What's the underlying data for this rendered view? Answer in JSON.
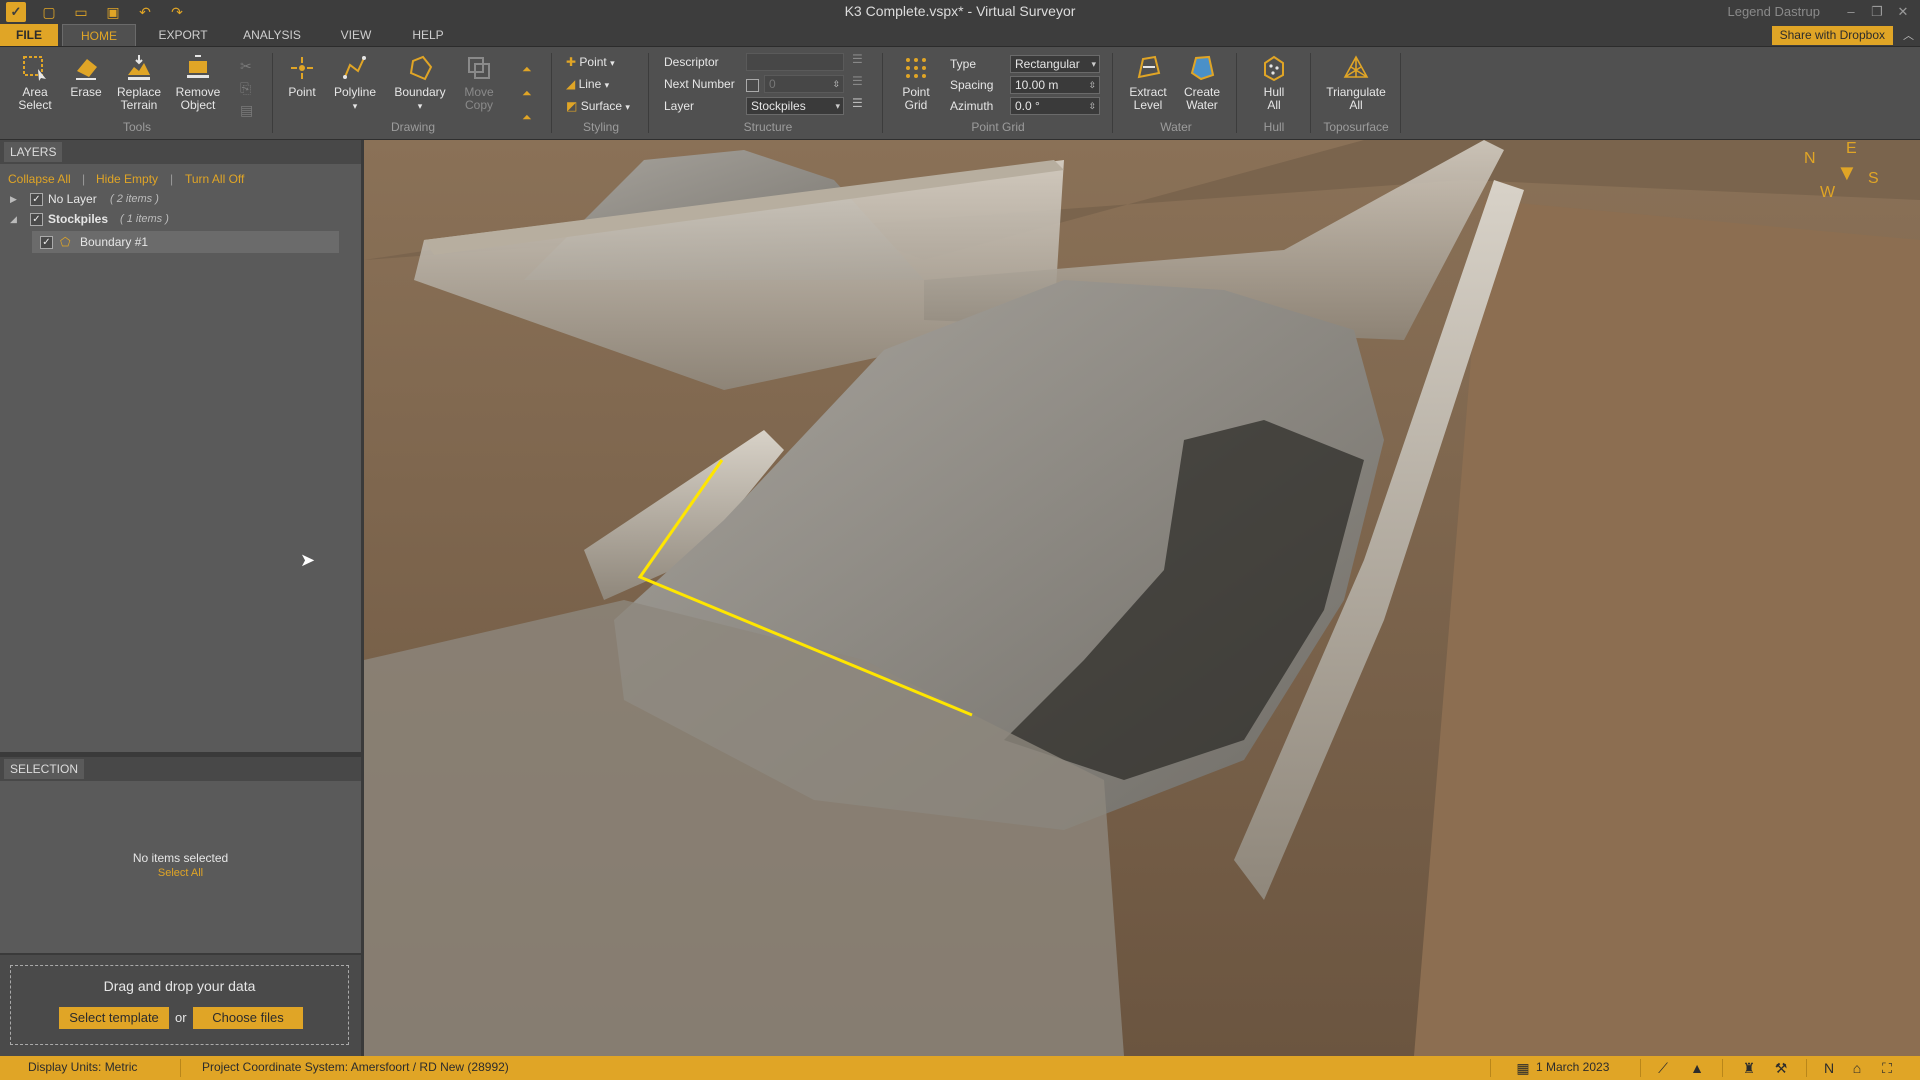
{
  "window": {
    "title": "K3 Complete.vspx*  -  Virtual Surveyor",
    "user": "Legend Dastrup",
    "share_button": "Share with Dropbox",
    "controls": {
      "minimize": "–",
      "restore": "❐",
      "close": "✕"
    }
  },
  "tabs": {
    "file": "FILE",
    "home": "HOME",
    "export": "EXPORT",
    "analysis": "ANALYSIS",
    "view": "VIEW",
    "help": "HELP"
  },
  "ribbon": {
    "tools": {
      "group_label": "Tools",
      "area_select": [
        "Area",
        "Select"
      ],
      "erase": "Erase",
      "replace_terrain": [
        "Replace",
        "Terrain"
      ],
      "remove_object": [
        "Remove",
        "Object"
      ]
    },
    "drawing": {
      "group_label": "Drawing",
      "point": "Point",
      "polyline": "Polyline",
      "boundary": "Boundary",
      "move_copy": [
        "Move",
        "Copy"
      ]
    },
    "styling": {
      "group_label": "Styling",
      "point": "Point",
      "line": "Line",
      "surface": "Surface"
    },
    "structure": {
      "group_label": "Structure",
      "descriptor_label": "Descriptor",
      "descriptor_value": "",
      "next_number_label": "Next Number",
      "next_number_value": "0",
      "layer_label": "Layer",
      "layer_value": "Stockpiles"
    },
    "point_grid": {
      "group_label": "Point Grid",
      "button": [
        "Point",
        "Grid"
      ],
      "type_label": "Type",
      "type_value": "Rectangular",
      "spacing_label": "Spacing",
      "spacing_value": "10.00 m",
      "azimuth_label": "Azimuth",
      "azimuth_value": "0.0 °"
    },
    "water": {
      "group_label": "Water",
      "extract_level": [
        "Extract",
        "Level"
      ],
      "create_water": [
        "Create",
        "Water"
      ]
    },
    "hull": {
      "group_label": "Hull",
      "hull_all": [
        "Hull",
        "All"
      ]
    },
    "toposurface": {
      "group_label": "Toposurface",
      "triangulate_all": [
        "Triangulate",
        "All"
      ]
    }
  },
  "layers": {
    "header": "LAYERS",
    "collapse_all": "Collapse All",
    "hide_empty": "Hide Empty",
    "turn_all_off": "Turn All Off",
    "separator": "|",
    "items": [
      {
        "name": "No Layer",
        "count": "( 2 items )"
      },
      {
        "name": "Stockpiles",
        "count": "( 1 items )"
      }
    ],
    "child": {
      "name": "Boundary #1"
    }
  },
  "selection": {
    "header": "SELECTION",
    "empty_text": "No items selected",
    "select_all": "Select All"
  },
  "drop": {
    "text": "Drag and drop your data",
    "select_template": "Select template",
    "or": "or",
    "choose_files": "Choose files"
  },
  "compass": {
    "n": "N",
    "e": "E",
    "s": "S",
    "w": "W"
  },
  "status": {
    "display_units": "Display Units:  Metric",
    "coordinate_system": "Project Coordinate System:   Amersfoort / RD New (28992)",
    "date": "1 March 2023"
  },
  "colors": {
    "accent": "#e0a526",
    "ribbon": "#505050",
    "panel": "#5a5a5a",
    "boundary_line": "#ffe600"
  }
}
